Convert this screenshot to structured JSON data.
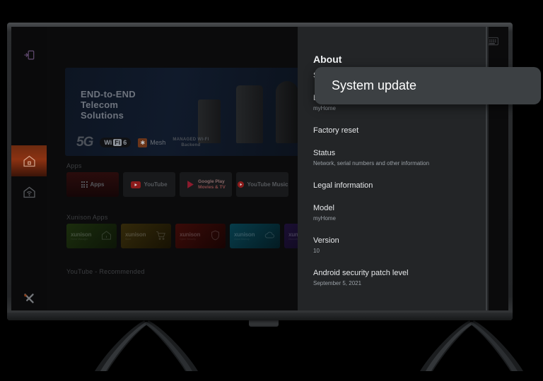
{
  "device": {
    "type": "television",
    "brand_mark": "x-logo"
  },
  "tv_ui": {
    "rail": [
      {
        "name": "input-source",
        "icon": "input-icon",
        "label": "Input"
      },
      {
        "name": "home",
        "icon": "home-icon",
        "label": "Home",
        "selected": true
      },
      {
        "name": "home-network",
        "icon": "home-wifi-icon",
        "label": "Home Network"
      },
      {
        "name": "brand",
        "icon": "xunison-x-icon",
        "label": "Xunison"
      }
    ],
    "topbar": [
      {
        "name": "voice-search",
        "icon": "microphone-icon"
      },
      {
        "name": "keyboard",
        "icon": "keyboard-icon"
      }
    ],
    "banner": {
      "headline_lines": [
        "END-to-END",
        "Telecom",
        "Solutions"
      ],
      "badges": {
        "five_g": "5G",
        "wifi": "Wi",
        "wifi_fi": "Fi",
        "wifi_gen": "6",
        "mesh": "Mesh",
        "managed_line1": "MANAGED WI-FI",
        "managed_line2": "Backend"
      }
    },
    "rows": [
      {
        "label": "Apps",
        "tiles": [
          {
            "name": "apps-tile",
            "label": "Apps",
            "icon": "grid-icon",
            "accent": "#2a0c0c"
          },
          {
            "name": "youtube-tile",
            "label": "YouTube",
            "icon": "youtube-icon",
            "accent": "#18191b"
          },
          {
            "name": "google-play-movies-tile",
            "label": "Google Play",
            "label2": "Movies & TV",
            "icon": "play-icon",
            "accent": "#18191b"
          },
          {
            "name": "youtube-music-tile",
            "label": "YouTube Music",
            "icon": "youtube-music-icon",
            "accent": "#18191b"
          }
        ],
        "add_label": "+"
      },
      {
        "label": "Xunison Apps",
        "tiles": [
          {
            "name": "xunison-home",
            "logo": "xunison",
            "sub": "Home Manager",
            "accent": "#16240c",
            "glyph": "home-icon"
          },
          {
            "name": "xunison-cart",
            "logo": "xunison",
            "sub": "Store",
            "accent": "#2a2206",
            "glyph": "cart-icon"
          },
          {
            "name": "xunison-security",
            "logo": "xunison",
            "sub": "Cyber Security",
            "accent": "#2c0806",
            "glyph": "shield-icon"
          },
          {
            "name": "xunison-cloud",
            "logo": "xunison",
            "sub": "Cloud Backup",
            "accent": "#06303c",
            "glyph": "cloud-icon"
          },
          {
            "name": "xunison-more",
            "logo": "xunison",
            "sub": "Discover",
            "accent": "#140a26",
            "glyph": "wave-icon"
          }
        ]
      },
      {
        "label": "YouTube  -  Recommended",
        "tiles": []
      }
    ]
  },
  "settings_panel": {
    "title": "About",
    "items": [
      {
        "title": "System update",
        "subtitle": ""
      },
      {
        "title": "Device name",
        "subtitle": "myHome"
      },
      {
        "title": "Factory reset",
        "subtitle": ""
      },
      {
        "title": "Status",
        "subtitle": "Network, serial numbers and other information"
      },
      {
        "title": "Legal information",
        "subtitle": ""
      },
      {
        "title": "Model",
        "subtitle": "myHome"
      },
      {
        "title": "Version",
        "subtitle": "10"
      },
      {
        "title": "Android security patch level",
        "subtitle": "September 5, 2021"
      }
    ]
  },
  "overlay": {
    "label": "System update",
    "background": "#3c4043",
    "text_color": "#ffffff"
  }
}
